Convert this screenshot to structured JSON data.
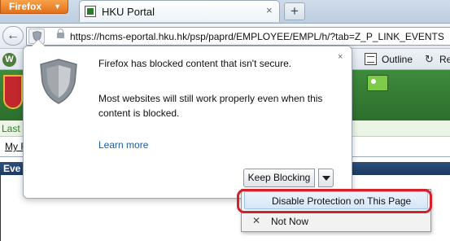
{
  "browser": {
    "menu_label": "Firefox",
    "menu_arrow": "▼",
    "tab_title": "HKU Portal",
    "tab_close": "×",
    "new_tab": "+",
    "url": "https://hcms-eportal.hku.hk/psp/paprd/EMPLOYEE/EMPL/h/?tab=Z_P_LINK_EVENTS",
    "back_icon": "←"
  },
  "bookmarks": {
    "w_label": "W",
    "outline_label": "Outline",
    "re_label": "Re",
    "re_icon": "↻"
  },
  "page": {
    "last_text": "Last I",
    "my_text": "My F",
    "eve_text": "Eve"
  },
  "popup": {
    "title": "Firefox has blocked content that isn't secure.",
    "body": "Most websites will still work properly even when this content is blocked.",
    "learn_more": "Learn more",
    "close": "×",
    "keep_blocking": "Keep Blocking"
  },
  "menu": {
    "disable_label": "Disable Protection on This Page",
    "not_now_label": "Not Now",
    "not_now_icon": "✕"
  },
  "colors": {
    "accent_orange": "#e3701b",
    "highlight_red": "#d4202a",
    "link_blue": "#1a5ea8",
    "banner_green": "#3d8b3d"
  }
}
